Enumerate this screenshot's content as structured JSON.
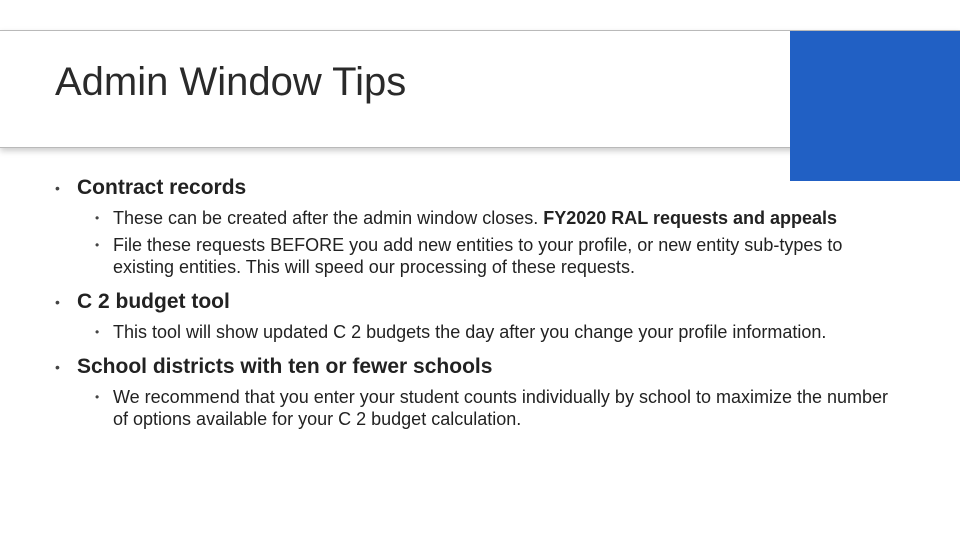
{
  "title": "Admin Window Tips",
  "sections": [
    {
      "heading": "Contract records",
      "items": [
        {
          "pre": "These can be created after the admin window closes. ",
          "bold": "FY2020 RAL requests and appeals",
          "post": ""
        },
        {
          "pre": "File these requests BEFORE you add new entities to your profile, or new entity sub-types to existing entities. This will speed our processing of these requests.",
          "bold": "",
          "post": ""
        }
      ]
    },
    {
      "heading": "C 2 budget tool",
      "items": [
        {
          "pre": "This tool will show updated C 2 budgets the day after you change your profile information.",
          "bold": "",
          "post": ""
        }
      ]
    },
    {
      "heading": "School districts with ten or fewer schools",
      "items": [
        {
          "pre": "We recommend that you enter your student counts individually by school to maximize the number of options available for your C 2 budget calculation.",
          "bold": "",
          "post": ""
        }
      ]
    }
  ]
}
